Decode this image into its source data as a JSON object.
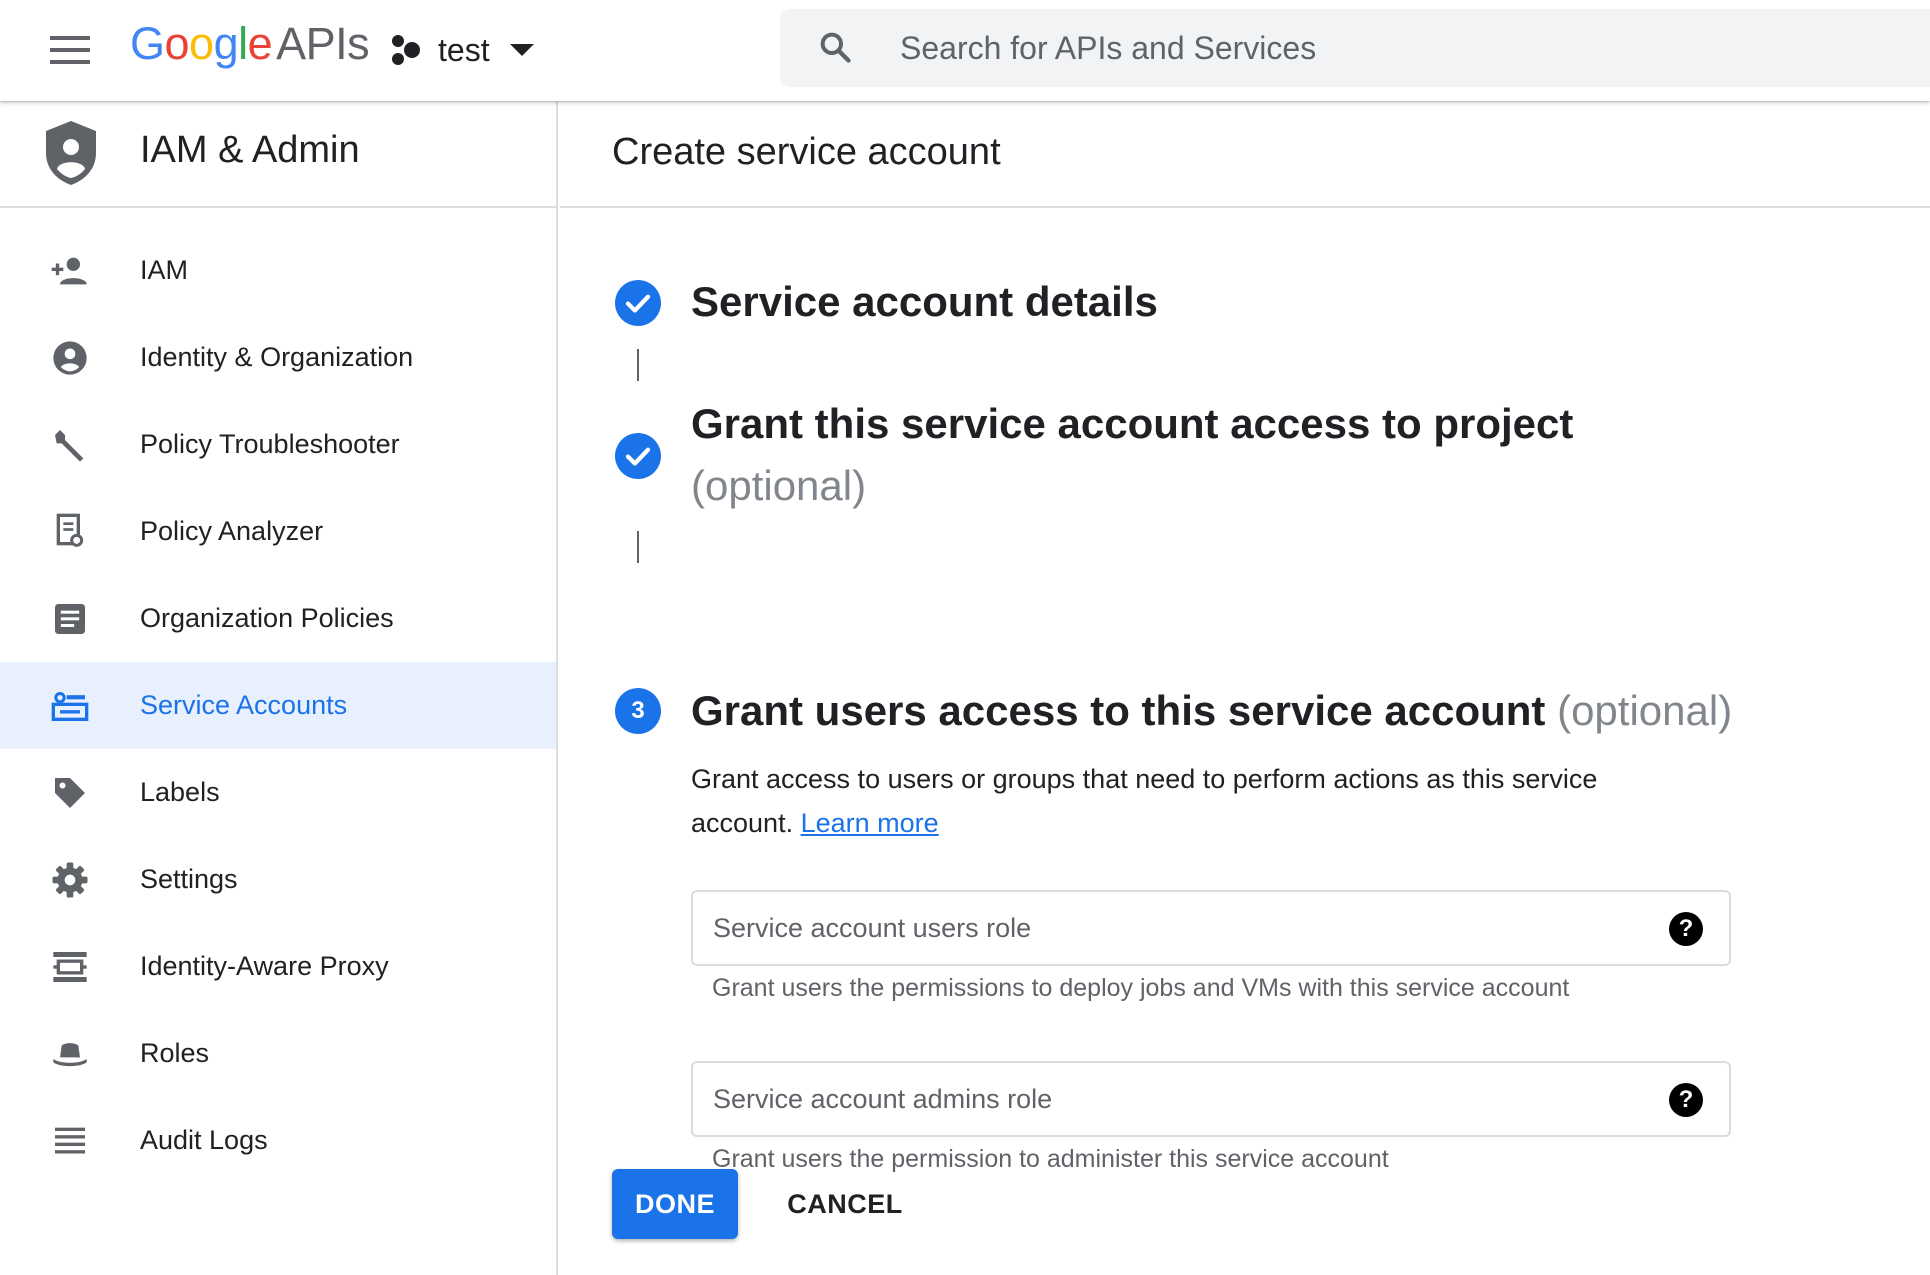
{
  "topbar": {
    "logo": {
      "g1": "G",
      "o1": "o",
      "o2": "o",
      "g2": "g",
      "l": "l",
      "e": "e",
      "apis": "APIs"
    },
    "project": {
      "name": "test"
    },
    "search": {
      "placeholder": "Search for APIs and Services"
    }
  },
  "sidebar": {
    "title": "IAM & Admin",
    "items": [
      {
        "label": "IAM",
        "icon": "person-add-icon",
        "active": false
      },
      {
        "label": "Identity & Organization",
        "icon": "account-circle-icon",
        "active": false
      },
      {
        "label": "Policy Troubleshooter",
        "icon": "wrench-icon",
        "active": false
      },
      {
        "label": "Policy Analyzer",
        "icon": "document-search-icon",
        "active": false
      },
      {
        "label": "Organization Policies",
        "icon": "list-document-icon",
        "active": false
      },
      {
        "label": "Service Accounts",
        "icon": "service-account-icon",
        "active": true
      },
      {
        "label": "Labels",
        "icon": "label-tag-icon",
        "active": false
      },
      {
        "label": "Settings",
        "icon": "gear-icon",
        "active": false
      },
      {
        "label": "Identity-Aware Proxy",
        "icon": "proxy-icon",
        "active": false
      },
      {
        "label": "Roles",
        "icon": "hat-icon",
        "active": false
      },
      {
        "label": "Audit Logs",
        "icon": "lines-icon",
        "active": false
      }
    ]
  },
  "main": {
    "page_title": "Create service account",
    "steps": [
      {
        "title": "Service account details",
        "status": "complete"
      },
      {
        "title": "Grant this service account access to project",
        "optional": "(optional)",
        "status": "complete"
      },
      {
        "number": "3",
        "title": "Grant users access to this service account",
        "optional": "(optional)",
        "status": "current"
      }
    ],
    "description": {
      "text_line1": "Grant access to users or groups that need to perform actions as this service",
      "text_line2": "account.",
      "link": "Learn more"
    },
    "fields": [
      {
        "placeholder": "Service account users role",
        "hint": "Grant users the permissions to deploy jobs and VMs with this service account"
      },
      {
        "placeholder": "Service account admins role",
        "hint": "Grant users the permission to administer this service account"
      }
    ],
    "buttons": {
      "done": "DONE",
      "cancel": "CANCEL"
    }
  },
  "colors": {
    "accent": "#1a73e8",
    "active_bg": "#e8f0fe",
    "google_blue": "#4285f4",
    "google_red": "#ea4335",
    "google_yellow": "#fbbc05",
    "google_green": "#34a853"
  }
}
